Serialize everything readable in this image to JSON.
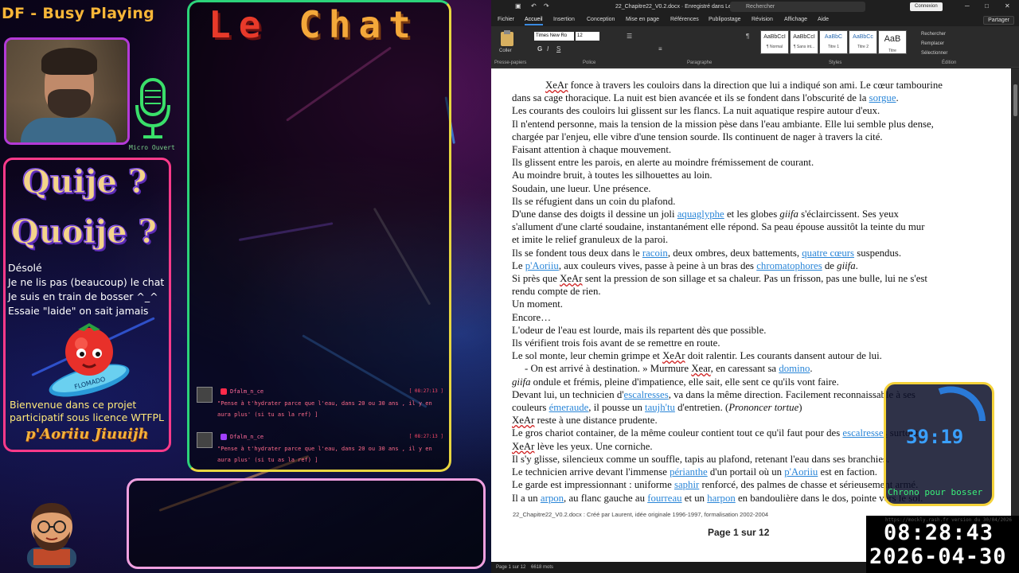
{
  "stream": {
    "title": "DF - Busy Playing",
    "mic_label": "Micro Ouvert"
  },
  "info_panel": {
    "heading1": "Quije ?",
    "heading2": "Quoije ?",
    "lines": [
      "Désolé",
      "Je ne lis pas (beaucoup) le chat",
      "Je suis en train de bosser ^_^",
      "Essaie \"laide\" on sait jamais"
    ],
    "tomato_label": "FLOMADO",
    "welcome1": "Bienvenue dans ce projet",
    "welcome2": "participatif sous licence WTFPL",
    "signature": "p'Aoriiu Jiuuijh"
  },
  "chat": {
    "title_left": "Le",
    "title_right": "Chat",
    "messages": [
      {
        "name": "Dfalm_n_ce",
        "time": "[ 08:27:13 ]",
        "text": "\"Pense à t'hydrater parce que l'eau, dans 20 ou 30 ans , il y en aura plus' (si tu as la ref) ]"
      },
      {
        "name": "Dfalm_n_ce",
        "time": "[ 08:27:13 ]",
        "text": "\"Pense à t'hydrater parce que l'eau, dans 20 ou 30 ans , il y en aura plus' (si tu as la ref) ]"
      }
    ]
  },
  "word": {
    "doc_title": "22_Chapitre22_V0.2.docx · Enregistré dans Lecteur l...",
    "search_placeholder": "Rechercher",
    "connect": "Connexion",
    "menu": [
      "Fichier",
      "Accueil",
      "Insertion",
      "Conception",
      "Mise en page",
      "Références",
      "Publipostage",
      "Révision",
      "Affichage",
      "Aide"
    ],
    "share": "Partager",
    "font_name": "Times New Ro",
    "font_size": "12",
    "groups": [
      "Presse-papiers",
      "Police",
      "Paragraphe",
      "Styles",
      "Édition"
    ],
    "paste": "Coller",
    "styles": [
      {
        "sample": "AaBbCcI",
        "name": "¶ Normal"
      },
      {
        "sample": "AaBbCcI",
        "name": "¶ Sans int..."
      },
      {
        "sample": "AaBbC",
        "name": "Titre 1"
      },
      {
        "sample": "AaBbCc",
        "name": "Titre 2"
      },
      {
        "sample": "AaB",
        "name": "Titre"
      }
    ],
    "editing": [
      "Rechercher",
      "Remplacer",
      "Sélectionner"
    ],
    "footer_info": "22_Chapitre22_V0.2.docx : Créé par Laurent, idée originale 1996-1997, formalisation 2002-2004",
    "page_label": "Page 1 sur 12",
    "status_page": "Page 1 sur 12",
    "status_words": "6618 mots"
  },
  "document_lines": [
    {
      "segments": [
        {
          "t": "XeAr",
          "c": "red"
        },
        {
          "t": " fonce à travers les couloirs dans la direction que lui a indiqué son ami. Le cœur tambourine"
        }
      ],
      "indent": true
    },
    {
      "segments": [
        {
          "t": "dans sa cage thoracique. La nuit est bien avancée et ils se fondent dans l'obscurité de la "
        },
        {
          "t": "sorgue",
          "c": "lnk"
        },
        {
          "t": "."
        }
      ]
    },
    {
      "segments": [
        {
          "t": "Les courants des couloirs lui glissent sur les flancs. La nuit aquatique respire autour d'eux."
        }
      ]
    },
    {
      "segments": [
        {
          "t": "Il n'entend personne, mais la tension de la mission pèse dans l'eau ambiante. Elle lui semble plus dense,"
        }
      ]
    },
    {
      "segments": [
        {
          "t": "chargée par l'enjeu, elle vibre d'une tension sourde. Ils continuent de nager à travers la cité."
        }
      ]
    },
    {
      "segments": [
        {
          "t": "Faisant attention à chaque mouvement."
        }
      ]
    },
    {
      "segments": [
        {
          "t": "Ils glissent entre les parois, en alerte au moindre frémissement de courant."
        }
      ]
    },
    {
      "segments": [
        {
          "t": "Au moindre bruit, à toutes les silhouettes au loin."
        }
      ]
    },
    {
      "segments": [
        {
          "t": "Soudain, une lueur. Une présence."
        }
      ]
    },
    {
      "segments": [
        {
          "t": "Ils se réfugient dans un coin du plafond."
        }
      ]
    },
    {
      "segments": [
        {
          "t": "D'une danse des doigts il dessine un joli "
        },
        {
          "t": "aquaglyphe",
          "c": "lnk"
        },
        {
          "t": " et les globes "
        },
        {
          "t": "giifa",
          "c": "ital"
        },
        {
          "t": " s'éclaircissent. Ses yeux"
        }
      ]
    },
    {
      "segments": [
        {
          "t": "s'allument d'une clarté soudaine, instantanément elle répond. Sa peau épouse aussitôt la teinte du mur"
        }
      ]
    },
    {
      "segments": [
        {
          "t": "et imite le relief granuleux de la paroi."
        }
      ]
    },
    {
      "segments": [
        {
          "t": "Ils se fondent tous deux dans le "
        },
        {
          "t": "racoin",
          "c": "lnk"
        },
        {
          "t": ", deux ombres, deux battements, "
        },
        {
          "t": "quatre cœurs",
          "c": "lnk"
        },
        {
          "t": " suspendus."
        }
      ]
    },
    {
      "segments": [
        {
          "t": "Le "
        },
        {
          "t": "p'Aoriiu",
          "c": "lnk"
        },
        {
          "t": ", aux couleurs vives, passe à peine à un bras des "
        },
        {
          "t": "chromatophores",
          "c": "lnk"
        },
        {
          "t": " de "
        },
        {
          "t": "giifa",
          "c": "ital"
        },
        {
          "t": "."
        }
      ]
    },
    {
      "segments": [
        {
          "t": "Si près que "
        },
        {
          "t": "XeAr",
          "c": "red"
        },
        {
          "t": " sent la pression de son sillage et sa chaleur. Pas un frisson, pas une bulle, lui ne s'est"
        }
      ]
    },
    {
      "segments": [
        {
          "t": "rendu compte de rien."
        }
      ]
    },
    {
      "segments": [
        {
          "t": "Un moment."
        }
      ]
    },
    {
      "segments": [
        {
          "t": "Encore…"
        }
      ]
    },
    {
      "segments": [
        {
          "t": "L'odeur de l'eau est lourde, mais ils repartent dès que possible."
        }
      ]
    },
    {
      "segments": [
        {
          "t": "Ils vérifient trois fois avant de se remettre en route."
        }
      ]
    },
    {
      "segments": [
        {
          "t": "Le sol monte, leur chemin grimpe et "
        },
        {
          "t": "XeAr",
          "c": "red"
        },
        {
          "t": " doit ralentir. Les courants dansent autour de lui."
        }
      ]
    },
    {
      "segments": [
        {
          "t": "-      On est arrivé à destination. » Murmure "
        },
        {
          "t": "Xear",
          "c": "red"
        },
        {
          "t": ", en caressant sa "
        },
        {
          "t": "domino",
          "c": "lnk"
        },
        {
          "t": "."
        }
      ],
      "dash": true
    },
    {
      "segments": [
        {
          "t": "giifa",
          "c": "ital"
        },
        {
          "t": " ondule et frémis, pleine d'impatience, elle sait, elle sent ce qu'ils vont faire."
        }
      ]
    },
    {
      "segments": [
        {
          "t": "Devant lui, un technicien d'"
        },
        {
          "t": "escalresses",
          "c": "lnk"
        },
        {
          "t": ", va dans la même direction. Facilement reconnaissable à ses"
        }
      ]
    },
    {
      "segments": [
        {
          "t": "couleurs "
        },
        {
          "t": "émeraude",
          "c": "lnk"
        },
        {
          "t": ", il pousse un "
        },
        {
          "t": "taujh'tu",
          "c": "lnk"
        },
        {
          "t": " d'entretien. ("
        },
        {
          "t": "Prononcer tortue",
          "c": "ital"
        },
        {
          "t": ")"
        }
      ]
    },
    {
      "segments": [
        {
          "t": "XeAr",
          "c": "red"
        },
        {
          "t": " reste à une distance prudente."
        }
      ]
    },
    {
      "segments": [
        {
          "t": "Le gros chariot container, de la même couleur contient tout ce qu'il faut pour des "
        },
        {
          "t": "escalresses",
          "c": "lnk"
        },
        {
          "t": " surtout."
        }
      ]
    },
    {
      "segments": [
        {
          "t": "XeAr",
          "c": "red"
        },
        {
          "t": " lève les yeux. Une corniche."
        }
      ]
    },
    {
      "segments": [
        {
          "t": "Il s'y glisse, silencieux comme un souffle, tapis au plafond, retenant l'eau dans ses branchies."
        }
      ]
    },
    {
      "segments": [
        {
          "t": "Le technicien arrive devant l'immense "
        },
        {
          "t": "périanthe",
          "c": "lnk"
        },
        {
          "t": " d'un portail où un "
        },
        {
          "t": "p'Aoriiu",
          "c": "lnk"
        },
        {
          "t": " est en faction."
        }
      ]
    },
    {
      "segments": [
        {
          "t": "Le garde est impressionnant : uniforme "
        },
        {
          "t": "saphir",
          "c": "lnk"
        },
        {
          "t": " renforcé, des palmes de chasse et sérieusement armé."
        }
      ]
    },
    {
      "segments": [
        {
          "t": "Il a un "
        },
        {
          "t": "arpon",
          "c": "lnk"
        },
        {
          "t": ", au flanc gauche au "
        },
        {
          "t": "fourreau",
          "c": "lnk"
        },
        {
          "t": " et un "
        },
        {
          "t": "harpon",
          "c": "lnk"
        },
        {
          "t": " en bandoulière dans le dos, pointe vers le sol."
        }
      ]
    }
  ],
  "chrono": {
    "time": "39:19",
    "label": "Chrono pour bosser"
  },
  "clock": {
    "url": "https://mockly.rash.fr  version du 30/04/2026",
    "time": "08:28:43",
    "date": "2026-04-30"
  },
  "colors": {
    "accent_word": "#3a8ae0",
    "link": "#2a86d8",
    "chrono_border": "#f4d23a",
    "chrono_text": "#3aa0ff"
  }
}
